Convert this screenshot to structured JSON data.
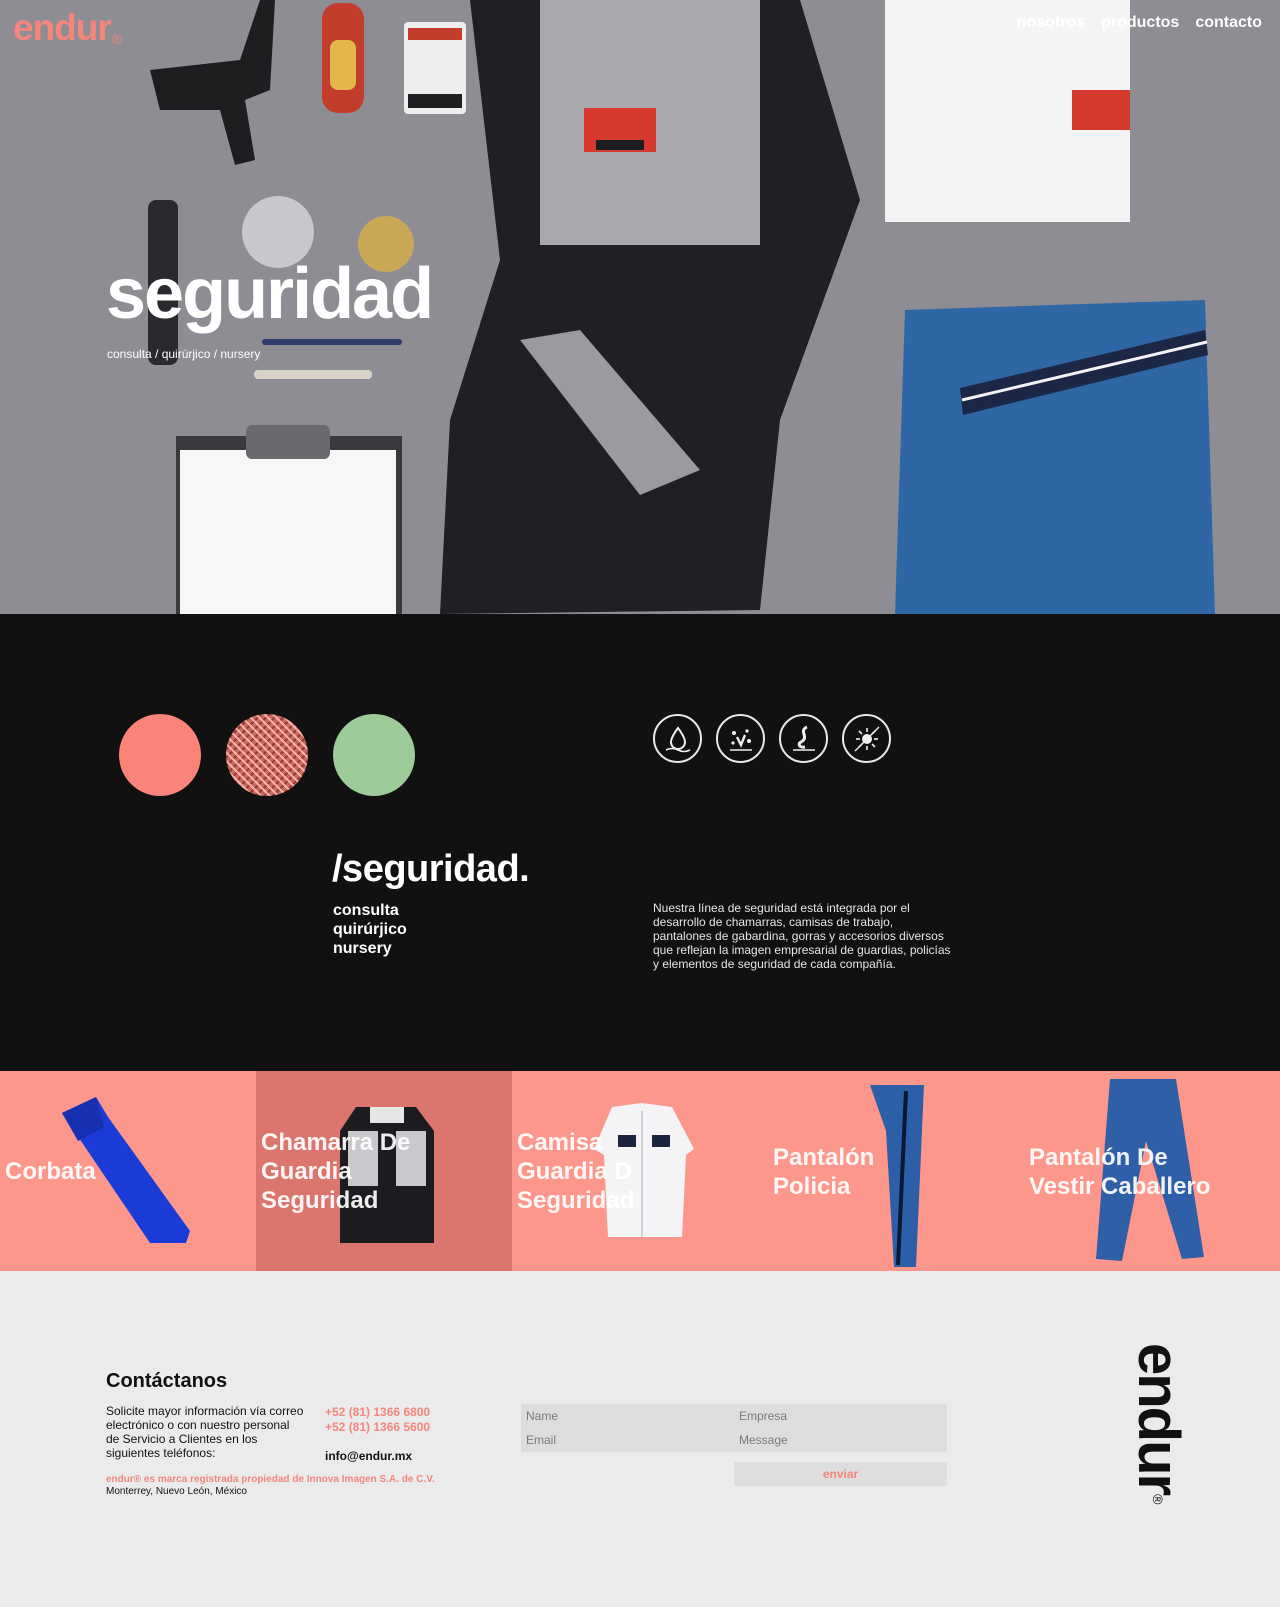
{
  "header": {
    "logo": "endur",
    "logo_mark": "®",
    "nav": [
      "nosotros",
      "productos",
      "contacto"
    ]
  },
  "hero": {
    "title": "seguridad",
    "subtitle": "consulta / quirúrjico / nursery"
  },
  "colors": {
    "brand_coral": "#f5867c",
    "swatch_coral": "#fa8479",
    "swatch_green": "#9ecb9a",
    "dark_bg": "#111112",
    "product_bg": "#fd978c",
    "product_active_bg": "#db766f"
  },
  "features": {
    "swatches": [
      "coral",
      "textured-weave",
      "green"
    ],
    "icons": [
      "water-repellent-icon",
      "stain-resistant-icon",
      "fabric-softener-icon",
      "antibacterial-icon"
    ]
  },
  "section": {
    "title": "/seguridad.",
    "list": [
      "consulta",
      "quirúrjico",
      "nursery"
    ],
    "description": "Nuestra línea de seguridad está integrada por el desarrollo de chamarras, camisas de trabajo, pantalones de gabardina, gorras y accesorios diversos que reflejan la imagen empresarial de guardias, policías y elementos de seguridad de cada compañía."
  },
  "products": [
    {
      "label": "Corbata",
      "image": "tie"
    },
    {
      "label": "Chamarra De Guardia Seguridad",
      "image": "jacket"
    },
    {
      "label": "Camisa Guardia D Seguridad",
      "image": "shirt"
    },
    {
      "label": "Pantalón Policia",
      "image": "pants-police"
    },
    {
      "label": "Pantalón De Vestir Caballero",
      "image": "pants-dress"
    }
  ],
  "contact": {
    "title": "Contáctanos",
    "text": "Solicite mayor información vía correo electrónico o con nuestro personal de Servicio a Clientes en los siguientes teléfonos:",
    "phone1": "+52 (81) 1366 6800",
    "phone2": "+52 (81) 1366 5600",
    "email": "info@endur.mx",
    "legal_brand": "endur® es marca registrada propiedad de Innova Imagen S.A. de C.V.",
    "location": "Monterrey, Nuevo León, México",
    "form": {
      "name_placeholder": "Name",
      "company_placeholder": "Empresa",
      "email_placeholder": "Email",
      "message_placeholder": "Message",
      "submit": "enviar"
    }
  },
  "footer_logo": "endur",
  "footer_logo_mark": "®"
}
